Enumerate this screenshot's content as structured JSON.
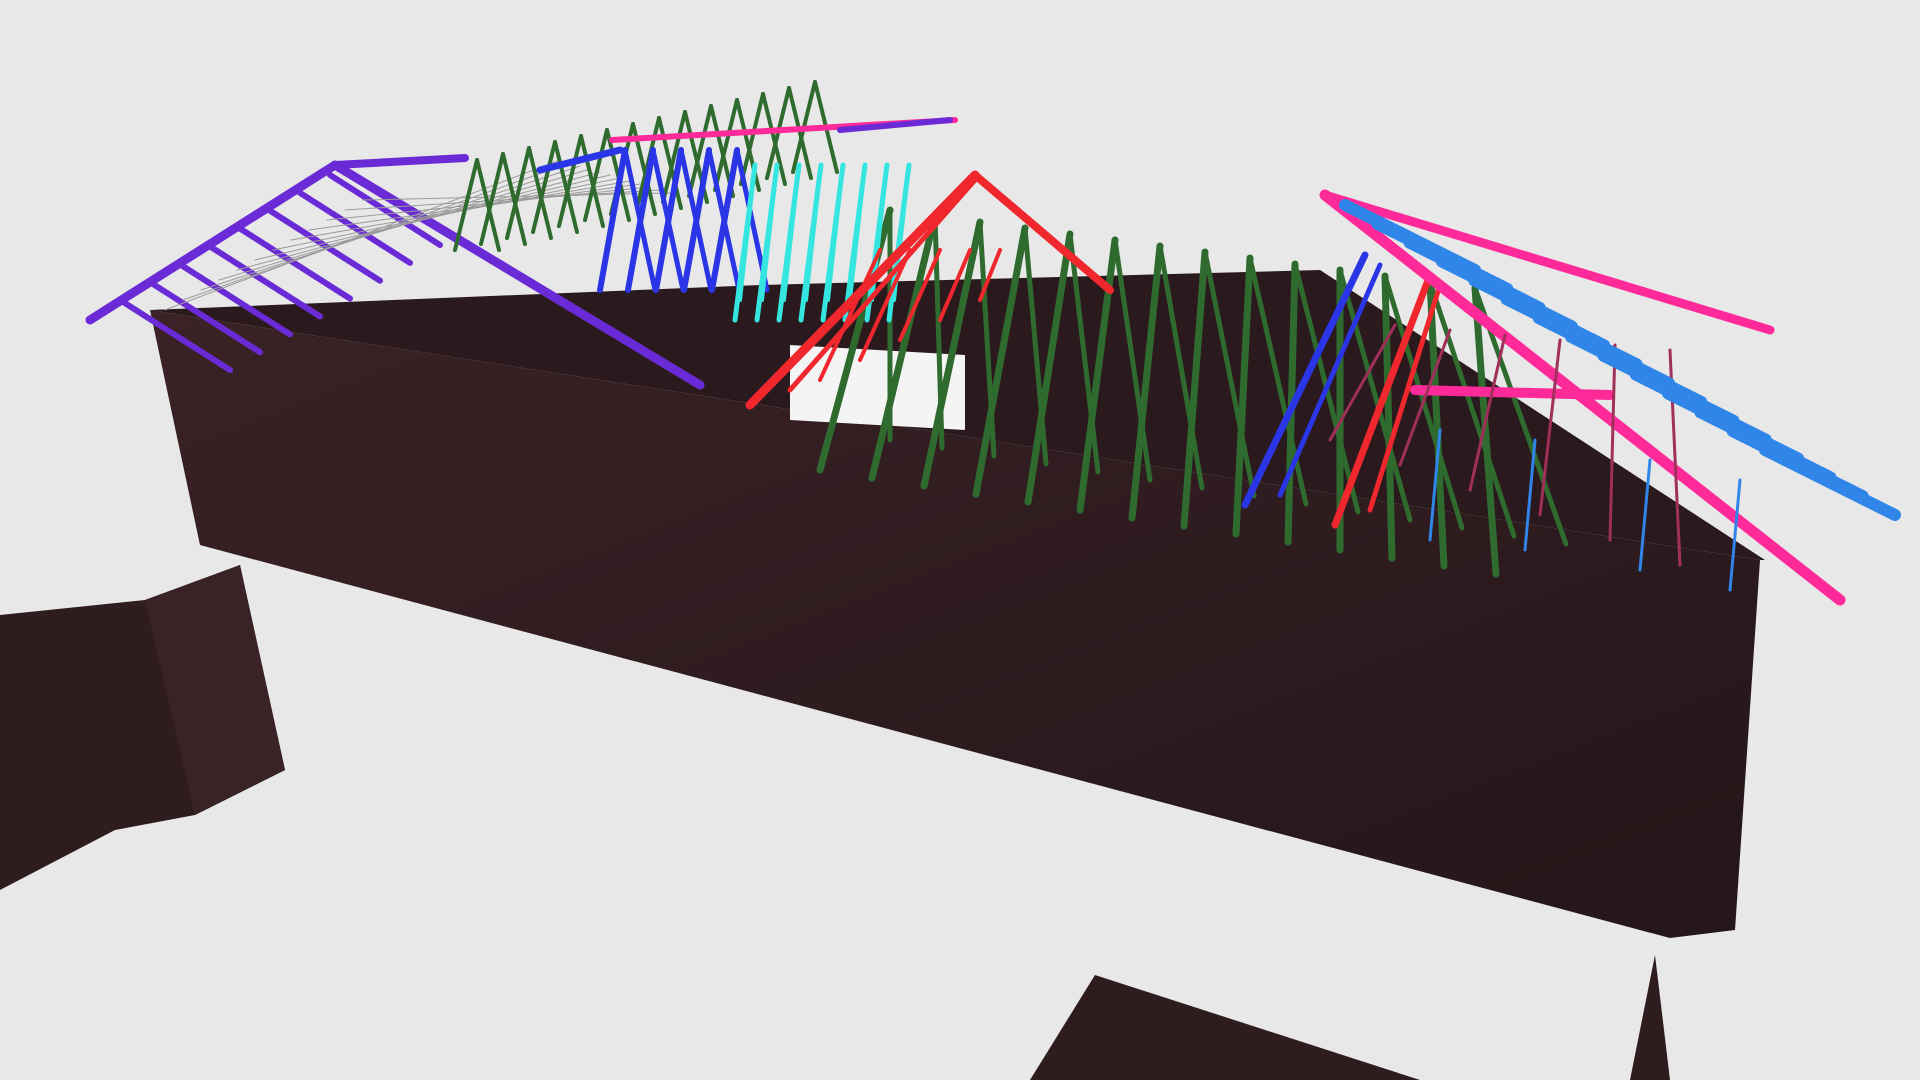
{
  "scene": {
    "background": "#e8e8e8",
    "wall_color": "#2e1c1f",
    "wall_shadow": "#231519",
    "truss_colors": {
      "purple": "#6a2bd6",
      "blue": "#2a35e6",
      "green": "#2f6b2f",
      "red": "#f0282e",
      "cyan": "#35e6e0",
      "magenta": "#ff2a9a",
      "sky_blue": "#2f86e8"
    }
  }
}
